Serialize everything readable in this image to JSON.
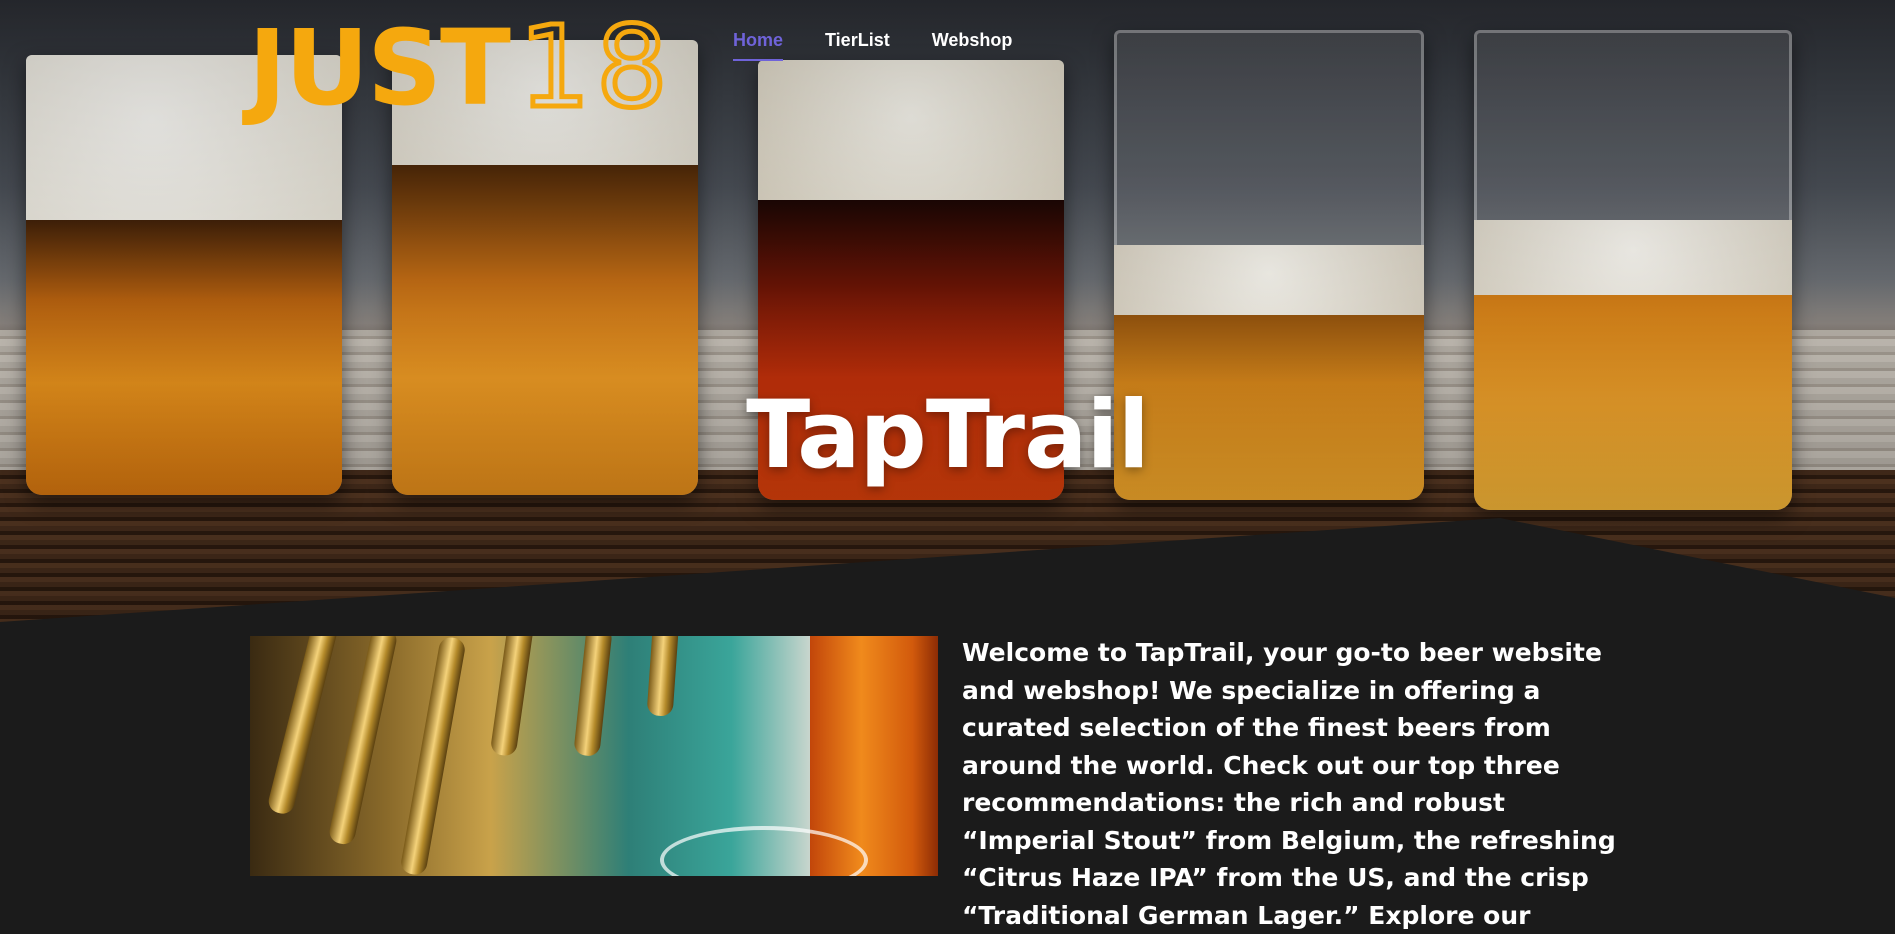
{
  "header": {
    "logo_solid": "JUST",
    "logo_outline": "18",
    "nav": [
      {
        "label": "Home",
        "active": true
      },
      {
        "label": "TierList",
        "active": false
      },
      {
        "label": "Webshop",
        "active": false
      }
    ]
  },
  "hero": {
    "title": "TapTrail",
    "image_subject": "five glasses of beer on a wooden flight tray"
  },
  "intro": {
    "text": "Welcome to TapTrail, your go-to beer website and webshop! We specialize in offering a curated selection of the finest beers from around the world. Check out our top three recommendations: the rich and robust “Imperial Stout” from Belgium, the refreshing “Citrus Haze IPA” from the US, and the crisp “Traditional German Lager.” Explore our"
  },
  "image": {
    "subject": "brass beer taps at a bar"
  },
  "colors": {
    "accent": "#f5a80e",
    "nav_active": "#6f63d9",
    "background": "#1b1b1b"
  }
}
